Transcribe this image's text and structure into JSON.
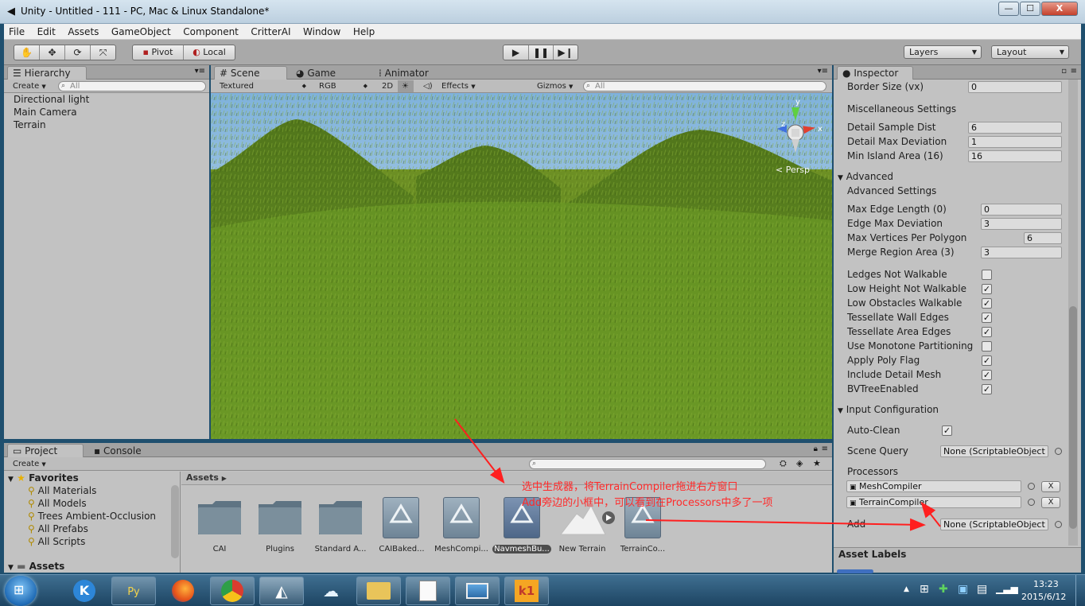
{
  "window": {
    "title": "Unity - Untitled - 111 - PC, Mac & Linux Standalone*",
    "min_label": "—",
    "max_label": "☐",
    "close_label": "X"
  },
  "menu": [
    "File",
    "Edit",
    "Assets",
    "GameObject",
    "Component",
    "CritterAI",
    "Window",
    "Help"
  ],
  "toolbar": {
    "pivot_label": "Pivot",
    "local_label": "Local",
    "layers_label": "Layers",
    "layout_label": "Layout"
  },
  "hierarchy": {
    "tab": "Hierarchy",
    "create_label": "Create",
    "search_placeholder": "All",
    "items": [
      "Directional light",
      "Main Camera",
      "Terrain"
    ]
  },
  "scene": {
    "tabs": [
      "Scene",
      "Game",
      "Animator"
    ],
    "render_mode": "Textured",
    "color_mode": "RGB",
    "mode_2d": "2D",
    "effects_label": "Effects",
    "gizmos_label": "Gizmos",
    "search_placeholder": "All",
    "persp_label": "Persp",
    "axis": {
      "x": "x",
      "y": "y",
      "z": "z"
    }
  },
  "project": {
    "tabs": [
      "Project",
      "Console"
    ],
    "create_label": "Create",
    "favorites_label": "Favorites",
    "favorites": [
      "All Materials",
      "All Models",
      "Trees Ambient-Occlusion",
      "All Prefabs",
      "All Scripts"
    ],
    "assets_root": "Assets",
    "breadcrumb": "Assets",
    "items": [
      {
        "label": "CAI",
        "kind": "folder"
      },
      {
        "label": "Plugins",
        "kind": "folder"
      },
      {
        "label": "Standard A...",
        "kind": "folder"
      },
      {
        "label": "CAIBaked...",
        "kind": "script"
      },
      {
        "label": "MeshCompi...",
        "kind": "script"
      },
      {
        "label": "NavmeshBu...",
        "kind": "script",
        "selected": true
      },
      {
        "label": "New Terrain",
        "kind": "terrain"
      },
      {
        "label": "TerrainCo...",
        "kind": "script"
      }
    ]
  },
  "inspector": {
    "tab": "Inspector",
    "border_size": {
      "label": "Border Size (vx)",
      "value": "0"
    },
    "misc_header": "Miscellaneous Settings",
    "detail_sample_dist": {
      "label": "Detail Sample Dist",
      "value": "6"
    },
    "detail_max_deviation": {
      "label": "Detail Max Deviation",
      "value": "1"
    },
    "min_island_area": {
      "label": "Min Island Area  (16)",
      "value": "16"
    },
    "advanced_foldout": "Advanced",
    "advanced_header": "Advanced Settings",
    "max_edge_length": {
      "label": "Max Edge Length  (0)",
      "value": "0"
    },
    "edge_max_deviation": {
      "label": "Edge Max Deviation",
      "value": "3"
    },
    "max_vertices": {
      "label": "Max Vertices Per Polygon",
      "value": "6"
    },
    "merge_region_area": {
      "label": "Merge Region Area  (3)",
      "value": "3"
    },
    "toggles": [
      {
        "label": "Ledges Not Walkable",
        "checked": false
      },
      {
        "label": "Low Height Not Walkable",
        "checked": true
      },
      {
        "label": "Low Obstacles Walkable",
        "checked": true
      },
      {
        "label": "Tessellate Wall Edges",
        "checked": true
      },
      {
        "label": "Tessellate Area Edges",
        "checked": true
      },
      {
        "label": "Use Monotone Partitioning",
        "checked": false
      },
      {
        "label": "Apply Poly Flag",
        "checked": true
      },
      {
        "label": "Include Detail Mesh",
        "checked": true
      },
      {
        "label": "BVTreeEnabled",
        "checked": true
      }
    ],
    "input_config_foldout": "Input Configuration",
    "auto_clean": {
      "label": "Auto-Clean",
      "checked": true
    },
    "scene_query": {
      "label": "Scene Query",
      "value": "None (ScriptableObject"
    },
    "processors_label": "Processors",
    "processors": [
      "MeshCompiler",
      "TerrainCompiler"
    ],
    "remove_label": "X",
    "add": {
      "label": "Add",
      "value": "None (ScriptableObject"
    },
    "asset_labels": "Asset Labels"
  },
  "annotation": {
    "line1": "选中生成器，将TerrainCompiler拖进右方窗口",
    "line2": "Add旁边的小框中，可以看到在Processors中多了一项",
    "color": "#ff2a2a"
  },
  "taskbar": {
    "apps": [
      "K",
      "Py",
      "Firefox",
      "Chrome",
      "Unity",
      "Cloud",
      "Explorer",
      "Notepad",
      "Photos",
      "k1"
    ],
    "time": "13:23",
    "date": "2015/6/12"
  }
}
